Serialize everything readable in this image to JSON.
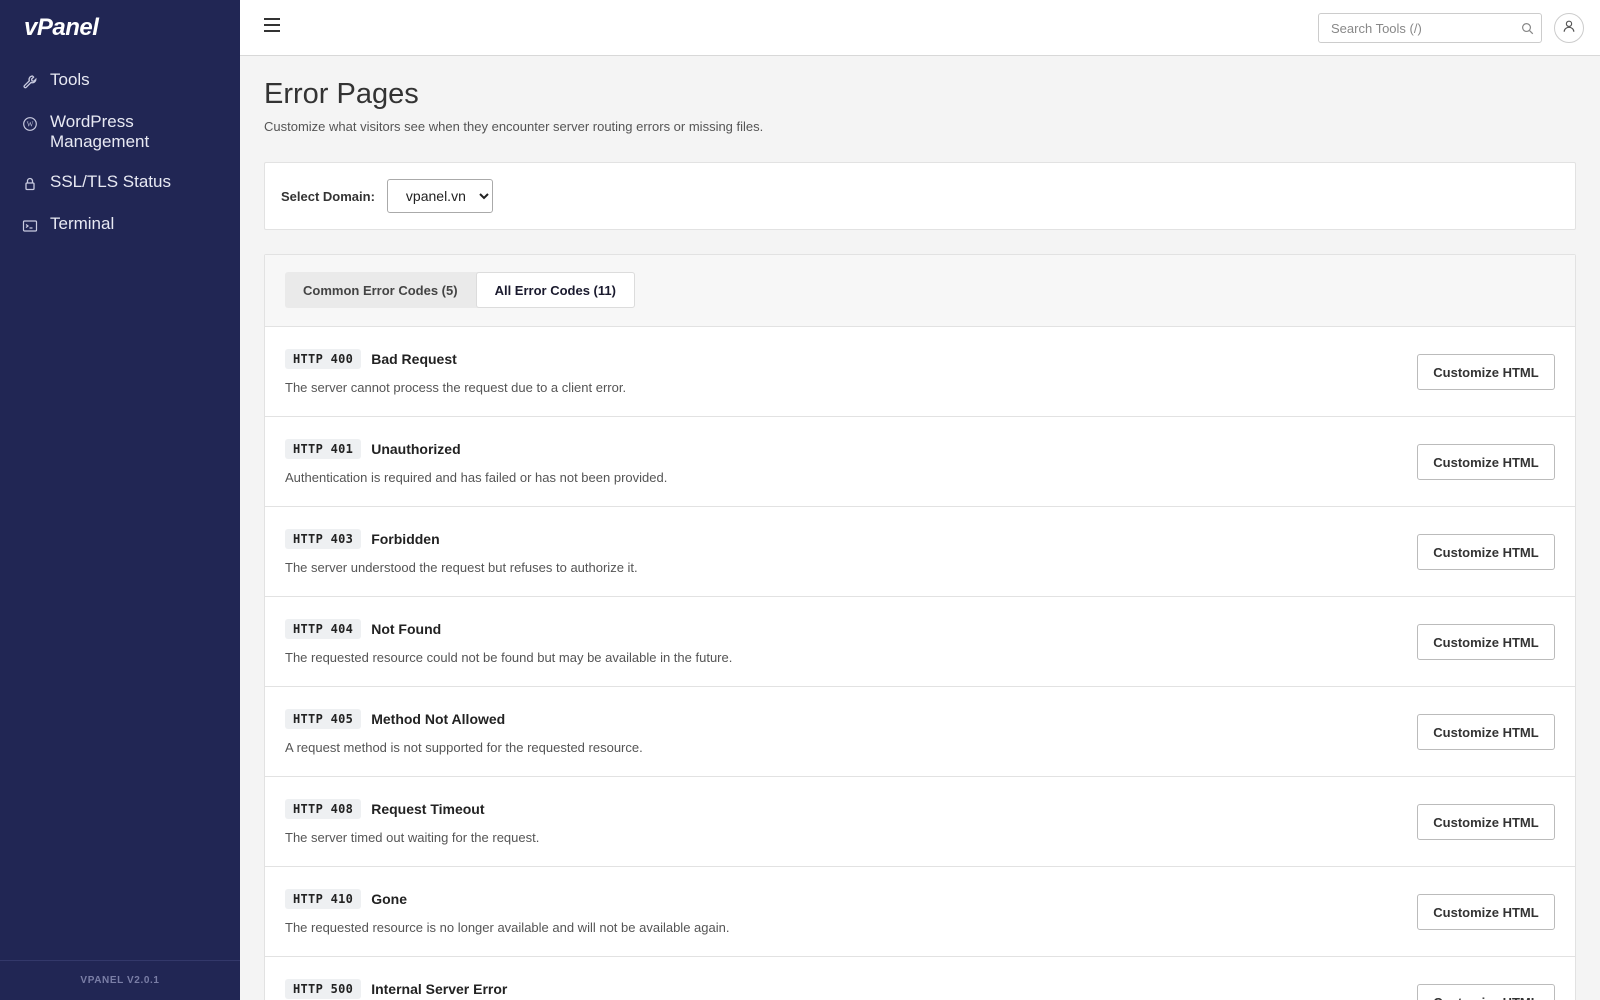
{
  "app": {
    "logo": "vPanel",
    "version": "VPANEL V2.0.1"
  },
  "sidebar": {
    "items": [
      {
        "label": "Tools",
        "icon": "wrench-icon"
      },
      {
        "label": "WordPress Management",
        "icon": "wordpress-icon"
      },
      {
        "label": "SSL/TLS Status",
        "icon": "lock-icon"
      },
      {
        "label": "Terminal",
        "icon": "terminal-icon"
      }
    ]
  },
  "topbar": {
    "search_placeholder": "Search Tools (/)"
  },
  "page": {
    "title": "Error Pages",
    "description": "Customize what visitors see when they encounter server routing errors or missing files."
  },
  "domain": {
    "label": "Select Domain:",
    "selected": "vpanel.vn"
  },
  "tabs": [
    {
      "label": "Common Error Codes (5)",
      "active": false
    },
    {
      "label": "All Error Codes (11)",
      "active": true
    }
  ],
  "codes": [
    {
      "code": "HTTP 400",
      "title": "Bad Request",
      "desc": "The server cannot process the request due to a client error.",
      "button": "Customize HTML"
    },
    {
      "code": "HTTP 401",
      "title": "Unauthorized",
      "desc": "Authentication is required and has failed or has not been provided.",
      "button": "Customize HTML"
    },
    {
      "code": "HTTP 403",
      "title": "Forbidden",
      "desc": "The server understood the request but refuses to authorize it.",
      "button": "Customize HTML"
    },
    {
      "code": "HTTP 404",
      "title": "Not Found",
      "desc": "The requested resource could not be found but may be available in the future.",
      "button": "Customize HTML"
    },
    {
      "code": "HTTP 405",
      "title": "Method Not Allowed",
      "desc": "A request method is not supported for the requested resource.",
      "button": "Customize HTML"
    },
    {
      "code": "HTTP 408",
      "title": "Request Timeout",
      "desc": "The server timed out waiting for the request.",
      "button": "Customize HTML"
    },
    {
      "code": "HTTP 410",
      "title": "Gone",
      "desc": "The requested resource is no longer available and will not be available again.",
      "button": "Customize HTML"
    },
    {
      "code": "HTTP 500",
      "title": "Internal Server Error",
      "desc": "",
      "button": "Customize HTML"
    }
  ]
}
